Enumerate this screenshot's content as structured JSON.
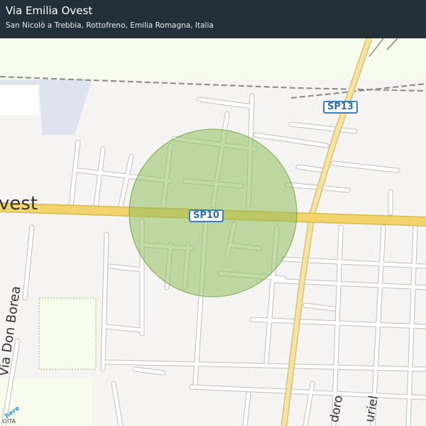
{
  "header": {
    "title": "Via Emilia Ovest",
    "subtitle": "San Nicolò a Trebbia, Rottofreno, Emilia Romagna, Italia"
  },
  "map": {
    "labels": {
      "sp10": "SP10",
      "sp13": "SP13",
      "main_road": "vest",
      "via_don_borea": "Via Don Borea",
      "road_bottom_1": "doro",
      "road_bottom_2": "uriel"
    },
    "colors": {
      "highlight_circle": "#8fbf5f",
      "main_road": "#f3d36b",
      "secondary_road": "#f7e3a0",
      "shield_border": "#3a7fc1",
      "water": "#dfe3ef",
      "park": "#f7fcec"
    },
    "attribution": "©ITA",
    "logo": "here"
  }
}
